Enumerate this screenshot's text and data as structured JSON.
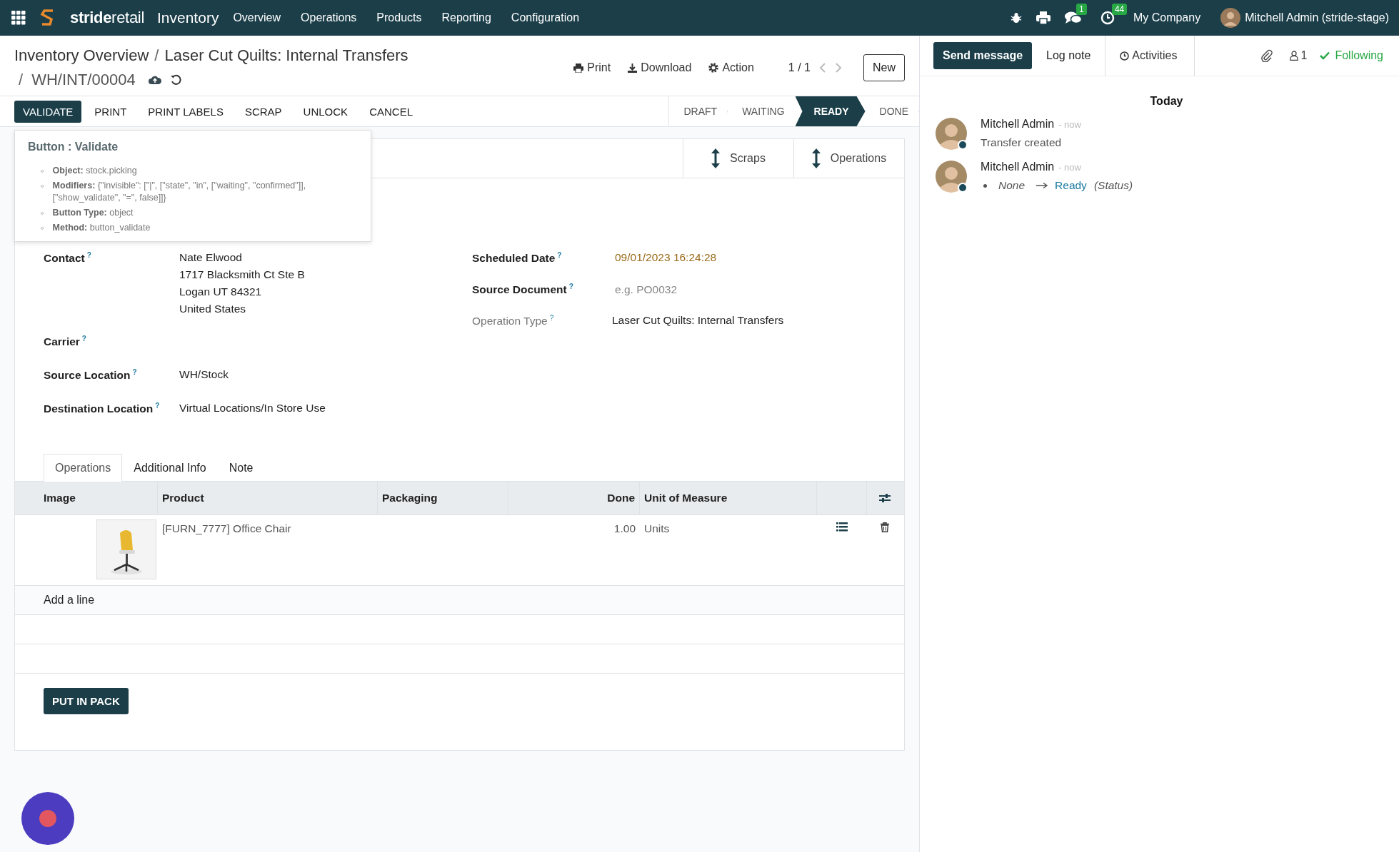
{
  "navbar": {
    "brand": "**stride**retail",
    "app": "Inventory",
    "menu": [
      "Overview",
      "Operations",
      "Products",
      "Reporting",
      "Configuration"
    ],
    "messages_badge": "1",
    "activities_badge": "44",
    "company": "My Company",
    "user": "Mitchell Admin (stride-stage)"
  },
  "breadcrumb_separator": "/",
  "breadcrumbs": [
    "Inventory Overview",
    "Laser Cut Quilts: Internal Transfers"
  ],
  "record": "WH/INT/00004",
  "actions": [
    "Print",
    "Download",
    "Action"
  ],
  "pager": "1 / 1",
  "new_button": "New",
  "buttons": [
    {
      "label": "VALIDATE",
      "primary": true
    },
    {
      "label": "PRINT",
      "primary": false
    },
    {
      "label": "PRINT LABELS",
      "primary": false
    },
    {
      "label": "SCRAP",
      "primary": false
    },
    {
      "label": "UNLOCK",
      "primary": false
    },
    {
      "label": "CANCEL",
      "primary": false
    }
  ],
  "statuses": [
    {
      "label": "DRAFT",
      "selected": false
    },
    {
      "label": "WAITING",
      "selected": false
    },
    {
      "label": "READY",
      "selected": true
    },
    {
      "label": "DONE",
      "selected": false
    }
  ],
  "tooltip": {
    "title": "Button : Validate",
    "bullet": "◦",
    "items": [
      {
        "label": "Object:",
        "value": "stock.picking"
      },
      {
        "label": "Modifiers:",
        "value": "{\"invisible\": [\"|\", [\"state\", \"in\", [\"waiting\", \"confirmed\"]], [\"show_validate\", \"=\", false]]}"
      },
      {
        "label": "Button Type:",
        "value": "object"
      },
      {
        "label": "Method:",
        "value": "button_validate"
      }
    ]
  },
  "smart_buttons": [
    "Scraps",
    "Operations"
  ],
  "help_mark": "?",
  "left_fields": [
    {
      "label": "Contact",
      "lines": [
        "Nate Elwood",
        "1717 Blacksmith Ct Ste B",
        "Logan UT 84321",
        "United States"
      ]
    },
    {
      "label": "Carrier"
    },
    {
      "label": "Source Location",
      "lines": [
        "WH/Stock"
      ]
    },
    {
      "label": "Destination Location",
      "lines": [
        "Virtual Locations/In Store Use"
      ]
    }
  ],
  "right_fields": [
    {
      "label": "Scheduled Date",
      "kind": "date",
      "value": "09/01/2023 16:24:28"
    },
    {
      "label": "Source Document",
      "kind": "input",
      "placeholder": "e.g. PO0032"
    },
    {
      "label": "Operation Type",
      "kind": "readonly",
      "value": "Laser Cut Quilts: Internal Transfers"
    }
  ],
  "tabs": [
    {
      "label": "Operations",
      "selected": true
    },
    {
      "label": "Additional Info",
      "selected": false
    },
    {
      "label": "Note",
      "selected": false
    }
  ],
  "table": {
    "columns": [
      "Image",
      "Product",
      "Packaging",
      "Done",
      "Unit of Measure"
    ],
    "rows": [
      {
        "product": "[FURN_7777] Office Chair",
        "done": "1.00",
        "uom": "Units"
      }
    ],
    "add_line": "Add a line"
  },
  "put_in_pack": "PUT IN PACK",
  "chatter": {
    "send_message": "Send message",
    "log_note": "Log note",
    "activities": "Activities",
    "followers": "1",
    "following": "Following",
    "separator": "Today",
    "messages": [
      {
        "author": "Mitchell Admin",
        "time": "- now",
        "kind": "text",
        "body": "Transfer created"
      },
      {
        "author": "Mitchell Admin",
        "time": "- now",
        "kind": "tracking",
        "old": "None",
        "new": "Ready",
        "field": "(Status)"
      }
    ]
  }
}
